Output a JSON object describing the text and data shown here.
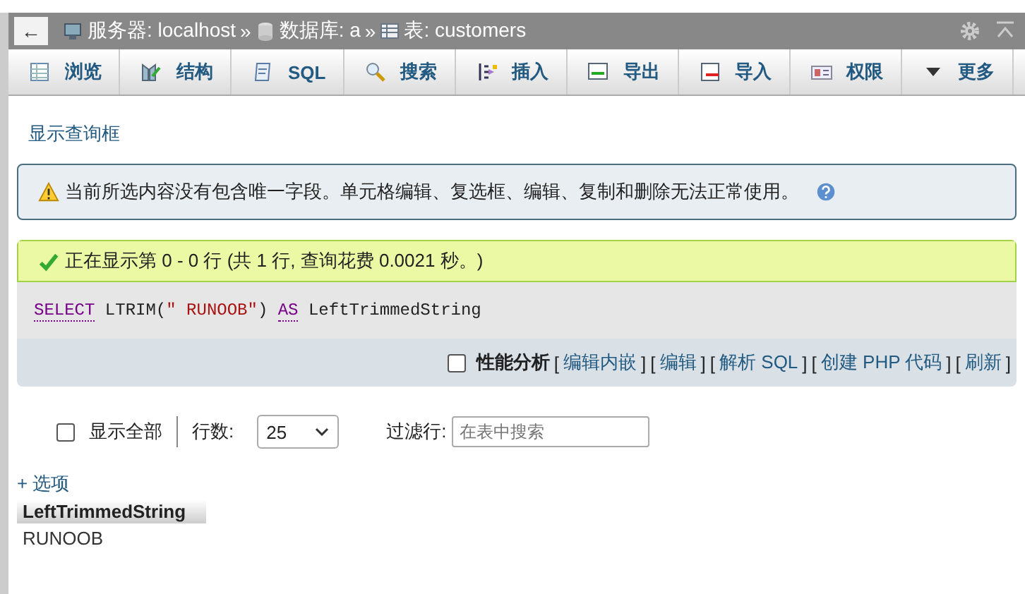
{
  "breadcrumb": {
    "back": "←",
    "items": [
      {
        "kind": "server",
        "text": "服务器: localhost"
      },
      {
        "kind": "database",
        "text": "数据库: a"
      },
      {
        "kind": "table",
        "text": "表: customers"
      }
    ],
    "separator": "»"
  },
  "tabs": [
    {
      "label": "浏览",
      "selected": false
    },
    {
      "label": "结构",
      "selected": false
    },
    {
      "label": "SQL",
      "selected": false
    },
    {
      "label": "搜索",
      "selected": false
    },
    {
      "label": "插入",
      "selected": false
    },
    {
      "label": "导出",
      "selected": false
    },
    {
      "label": "导入",
      "selected": false
    },
    {
      "label": "权限",
      "selected": false
    },
    {
      "label": "更多",
      "selected": false
    }
  ],
  "query_box_link": "显示查询框",
  "warning": "当前所选内容没有包含唯一字段。单元格编辑、复选框、编辑、复制和删除无法正常使用。",
  "success": "正在显示第 0 - 0 行 (共 1 行, 查询花费 0.0021 秒。)",
  "sql": [
    {
      "kind": "keyword",
      "text": "SELECT"
    },
    {
      "kind": "plain",
      "text": " LTRIM("
    },
    {
      "kind": "string",
      "text": "\" RUNOOB\""
    },
    {
      "kind": "plain",
      "text": ") "
    },
    {
      "kind": "keyword",
      "text": "AS"
    },
    {
      "kind": "plain",
      "text": " LeftTrimmedString"
    }
  ],
  "profiling": {
    "label": "性能分析",
    "checked": false
  },
  "sql_links": [
    {
      "open": "[",
      "text": "编辑内嵌",
      "close": "]"
    },
    {
      "open": "[",
      "text": "编辑",
      "close": "]"
    },
    {
      "open": "[",
      "text": "解析 SQL",
      "close": "]"
    },
    {
      "open": "[",
      "text": "创建 PHP 代码",
      "close": "]"
    },
    {
      "open": "[",
      "text": "刷新",
      "close": "]"
    }
  ],
  "show_all": {
    "label": "显示全部",
    "checked": false
  },
  "rows_label": "行数:",
  "rows_value": "25",
  "filter_label": "过滤行:",
  "filter_placeholder": "在表中搜索",
  "options_link": "+ 选项",
  "table": {
    "columns": [
      "LeftTrimmedString"
    ],
    "rows": [
      [
        "RUNOOB"
      ]
    ]
  }
}
